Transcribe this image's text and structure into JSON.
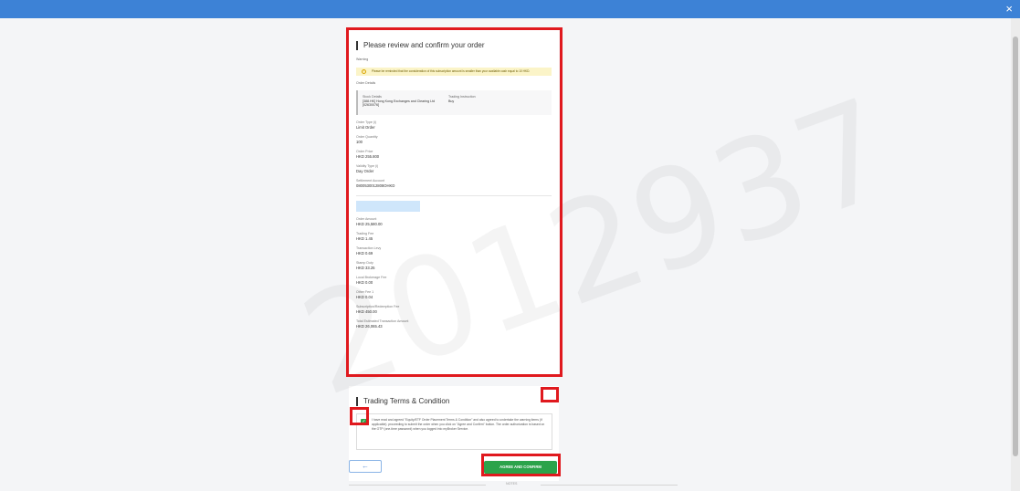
{
  "window": {
    "close_icon": "×"
  },
  "watermark": "2012937",
  "order": {
    "title": "Please review and confirm your order",
    "warning_label": "Warning",
    "warning_text": "Please be reminded that the consideration of this subscription amount is smaller than your available cash equal to 10 HKD.",
    "order_details_label": "Order Details",
    "stock_details_label": "Stock Details",
    "stock_details_value": "[388.HK] Hong Kong Exchanges and Clearing Ltd [02630076]",
    "trading_instruction_label": "Trading Instruction",
    "trading_instruction_value": "Buy",
    "fields": [
      {
        "label": "Order Type (i)",
        "value": "Limit Order"
      },
      {
        "label": "Order Quantity",
        "value": "100"
      },
      {
        "label": "Order Price",
        "value": "HKD 255.800"
      },
      {
        "label": "Validity Type (i)",
        "value": "Day Order"
      },
      {
        "label": "Settlement Account",
        "value": "0800530012808OHKD"
      }
    ],
    "fees": [
      {
        "label": "Order Amount",
        "value": "HKD 25,580.00"
      },
      {
        "label": "Trading Fee",
        "value": "HKD 1.45"
      },
      {
        "label": "Transaction Levy",
        "value": "HKD 0.69"
      },
      {
        "label": "Stamp Duty",
        "value": "HKD 33.25"
      },
      {
        "label": "Local Brokerage Fee",
        "value": "HKD 0.00"
      },
      {
        "label": "Other Fee 1",
        "value": "HKD 0.04"
      },
      {
        "label": "Subscription/Redemption Fee",
        "value": "HKD 450.00"
      },
      {
        "label": "Total Estimated Transaction Amount",
        "value": "HKD 26,065.43"
      }
    ]
  },
  "terms": {
    "title": "Trading Terms & Condition",
    "checkbox_mark": "✓",
    "text": "I have read and agreed \"Equity/ETF Order Placement Terms & Condition\" and also agreed to undertake the warning items (if applicable). proceeding to submit the order when you click on \"Agree and Confirm\" button. The order authorization is based on the OTP (one-time password) when you logged into myBroker Service."
  },
  "buttons": {
    "back": "←",
    "agree": "AGREE AND CONFIRM"
  },
  "footer": {
    "notes": "NOTES"
  },
  "colors": {
    "accent_blue": "#3d82d6",
    "confirm_green": "#2ba34a",
    "highlight_red": "#e0191e"
  }
}
